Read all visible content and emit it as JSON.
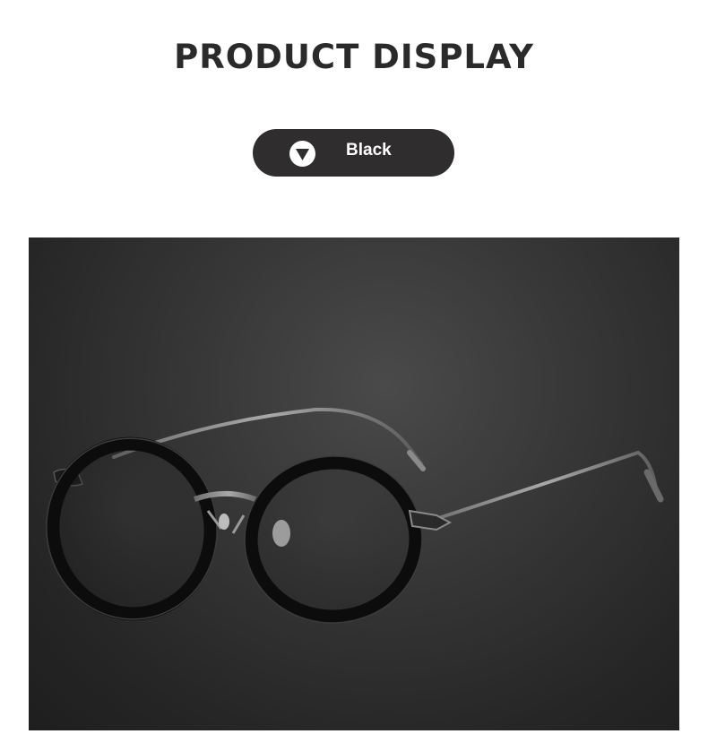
{
  "header": {
    "title": "PRODUCT DISPLAY"
  },
  "color_option": {
    "label": "Black",
    "icon": "triangle-down-icon",
    "background": "#2f2d2e"
  },
  "product_image": {
    "subject": "eyeglasses-image",
    "frame_color": "#0c0c0c",
    "temple_color": "#8a8a8a"
  }
}
